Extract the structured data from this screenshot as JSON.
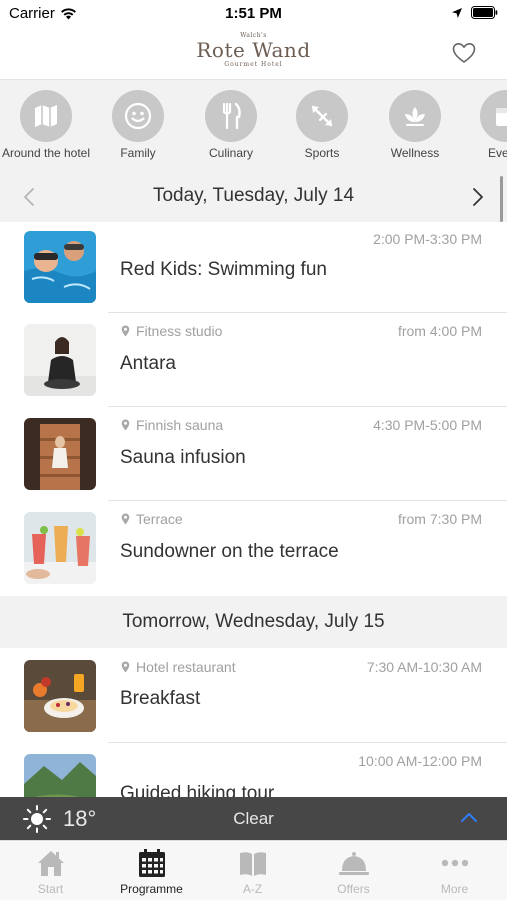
{
  "status_bar": {
    "carrier": "Carrier",
    "time": "1:51 PM"
  },
  "header": {
    "logo": {
      "top": "Walch's",
      "main": "Rote Wand",
      "sub": "Gourmet Hotel"
    }
  },
  "categories": [
    {
      "label": "Around the hotel",
      "icon": "map-icon"
    },
    {
      "label": "Family",
      "icon": "smiley-icon"
    },
    {
      "label": "Culinary",
      "icon": "cutlery-icon"
    },
    {
      "label": "Sports",
      "icon": "arrows-icon"
    },
    {
      "label": "Wellness",
      "icon": "lotus-icon"
    },
    {
      "label": "Eve",
      "icon": "event-icon"
    }
  ],
  "date_nav": {
    "title": "Today, Tuesday, July 14"
  },
  "events_today": [
    {
      "location": "",
      "time": "2:00 PM-3:30 PM",
      "title": "Red Kids: Swimming fun"
    },
    {
      "location": "Fitness studio",
      "time": "from 4:00 PM",
      "title": "Antara"
    },
    {
      "location": "Finnish sauna",
      "time": "4:30 PM-5:00 PM",
      "title": "Sauna infusion"
    },
    {
      "location": "Terrace",
      "time": "from 7:30 PM",
      "title": "Sundowner on the terrace"
    }
  ],
  "section_tomorrow": {
    "title": "Tomorrow, Wednesday, July 15"
  },
  "events_tomorrow": [
    {
      "location": "Hotel restaurant",
      "time": "7:30 AM-10:30 AM",
      "title": "Breakfast"
    },
    {
      "location": "",
      "time": "10:00 AM-12:00 PM",
      "title": "Guided hiking tour"
    }
  ],
  "weather": {
    "temperature": "18°",
    "condition": "Clear",
    "icon": "sun-icon"
  },
  "tabbar": {
    "active": "Programme",
    "tabs": [
      {
        "label": "Start",
        "icon": "house-icon"
      },
      {
        "label": "Programme",
        "icon": "calendar-icon"
      },
      {
        "label": "A-Z",
        "icon": "book-icon"
      },
      {
        "label": "Offers",
        "icon": "cloche-icon"
      },
      {
        "label": "More",
        "icon": "more-icon"
      }
    ]
  },
  "colors": {
    "accent": "#2f7cf6",
    "category_circle": "#c8c8c8",
    "weather_bar": "#474747",
    "muted_text": "#a0a0a0"
  }
}
